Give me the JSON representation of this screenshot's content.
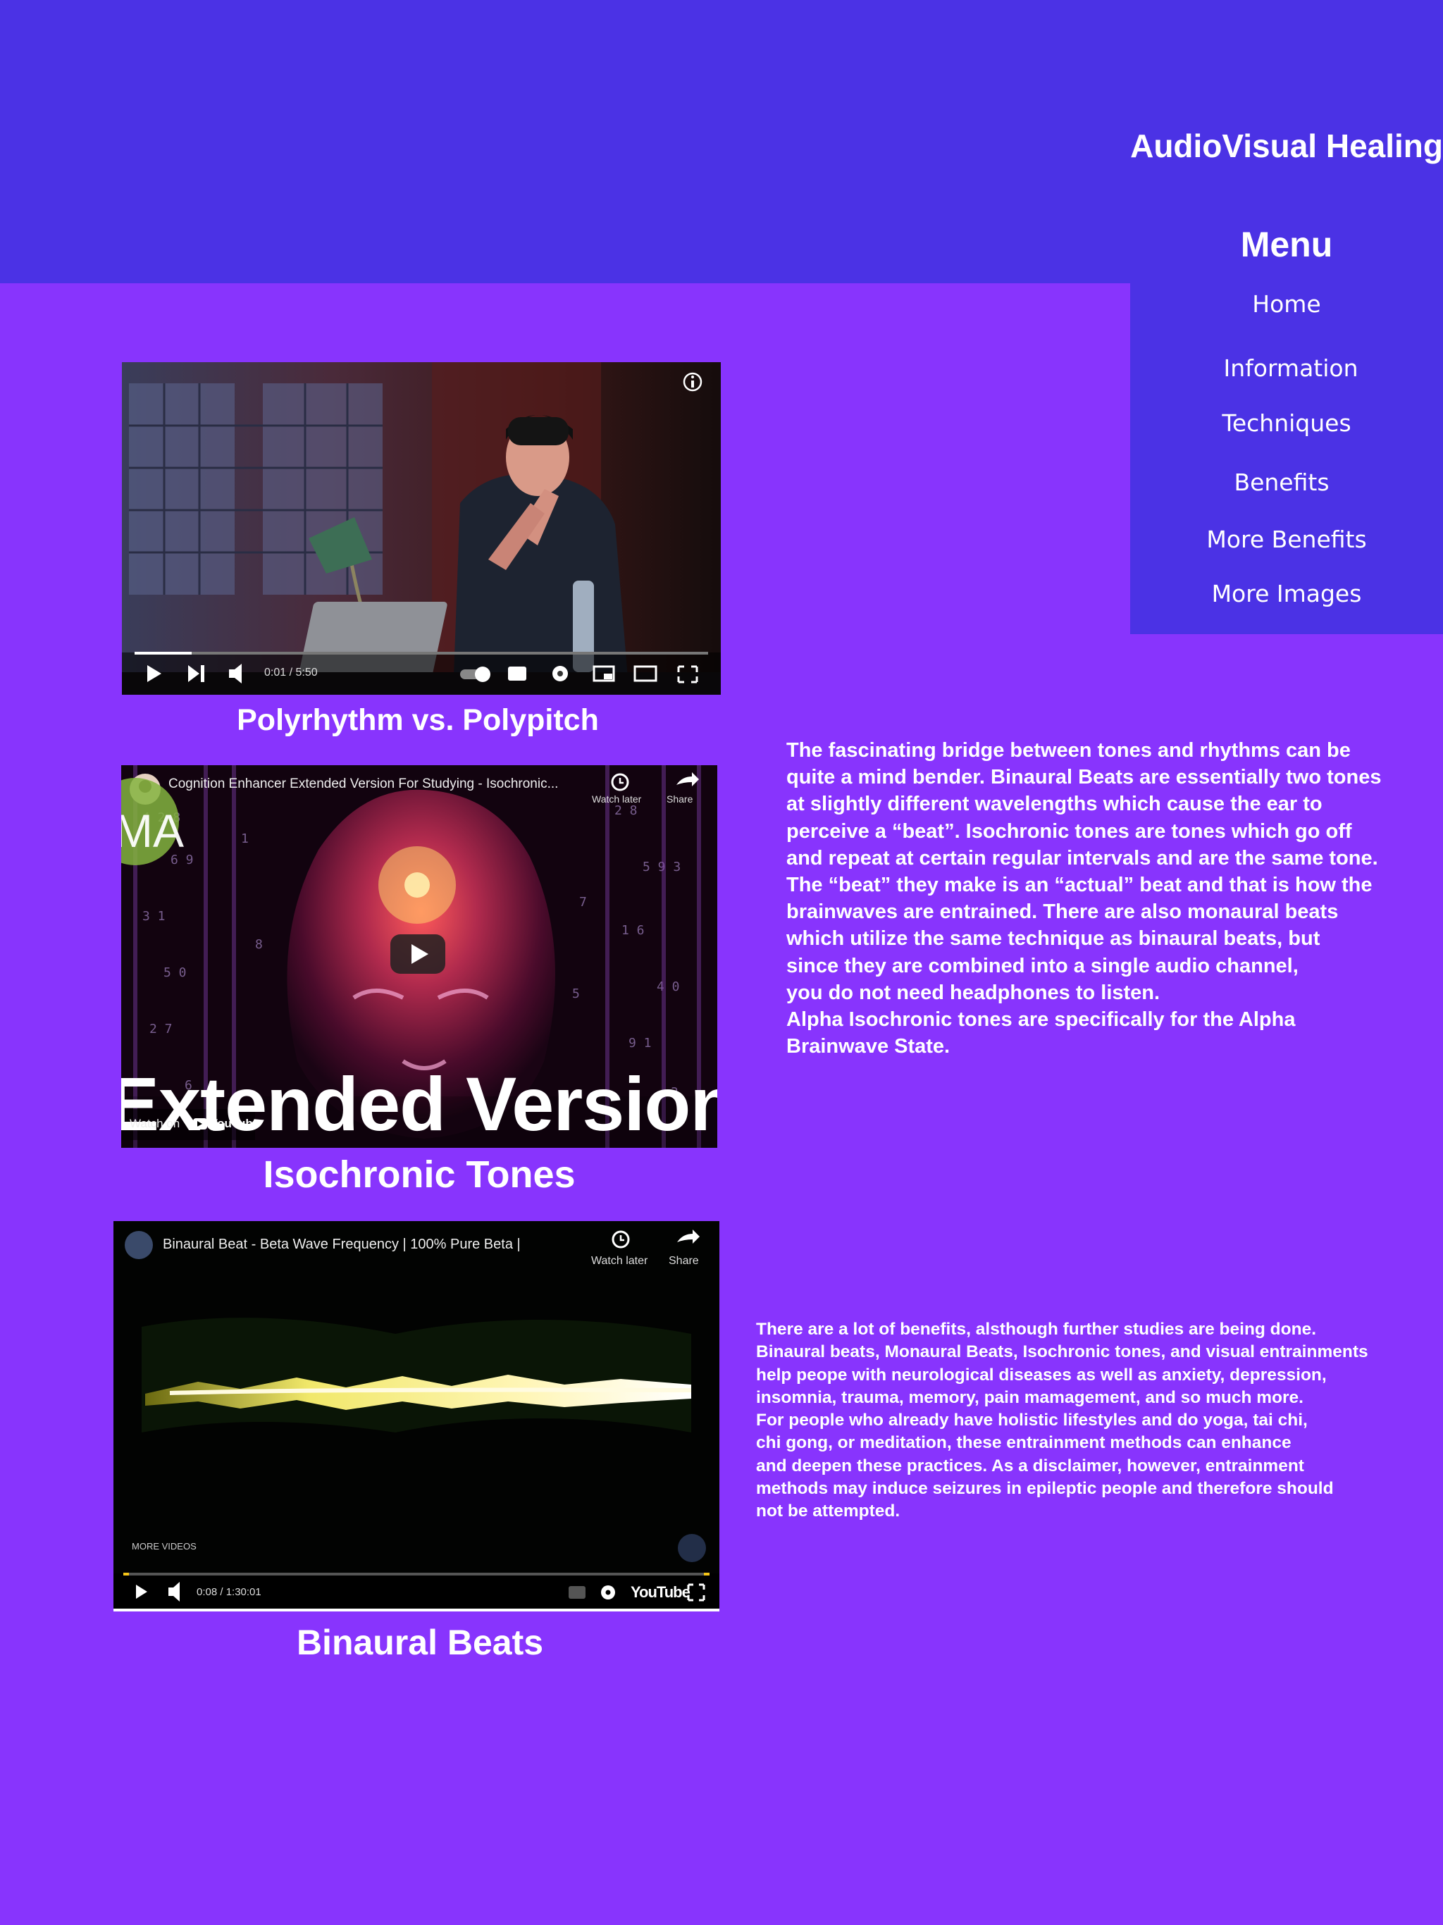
{
  "header": {
    "site_title": "AudioVisual Healing"
  },
  "menu": {
    "title": "Menu",
    "items": [
      "Home",
      "Information",
      "Techniques",
      "Benefits",
      "More Benefits",
      "More Images"
    ]
  },
  "videos": [
    {
      "caption": "Polyrhythm vs. Polypitch",
      "time": "0:01 / 5:50",
      "progress": 0.1
    },
    {
      "caption": "Isochronic Tones",
      "title": "Cognition Enhancer Extended Version For Studying - Isochronic...",
      "channel_badge": "MA",
      "overlay_text": "Extended Version",
      "watch_later": "Watch later",
      "share": "Share",
      "watch_on": "Watch on",
      "youtube": "YouTube"
    },
    {
      "caption": "Binaural Beats",
      "title": "Binaural Beat - Beta Wave Frequency | 100% Pure Beta |",
      "watch_later": "Watch later",
      "share": "Share",
      "more_videos": "MORE VIDEOS",
      "time": "0:08 / 1:30:01",
      "youtube": "YouTube",
      "progress": 0.01
    }
  ],
  "content": {
    "tones_paragraph": "The fascinating bridge between tones and rhythms can be\nquite a mind bender. Binaural Beats are essentially two tones\nat slightly different wavelengths which cause the ear to\nperceive a “beat”. Isochronic tones are tones which go off\nand repeat at certain regular intervals and are the same tone.\nThe “beat” they make is an “actual” beat and that is how the\nbrainwaves are entrained. There are also monaural beats\nwhich utilize the same technique as binaural beats, but\nsince they are combined into a single audio channel,\nyou do not need headphones to listen.\nAlpha Isochronic tones are specifically for the Alpha\nBrainwave State.",
    "benefits_paragraph": "There are a lot of benefits, alsthough further studies are being done.\nBinaural beats, Monaural Beats, Isochronic tones, and visual entrainments\nhelp peope with neurological diseases as well as anxiety, depression,\ninsomnia, trauma, memory, pain mamagement, and so much more.\nFor people who already have holistic lifestyles and do yoga, tai chi,\nchi gong, or meditation, these entrainment methods can enhance\nand deepen these practices. As a disclaimer, however, entrainment\nmethods may induce seizures in epileptic people and therefore should\nnot be attempted."
  },
  "colors": {
    "page_bg": "#8834fd",
    "header_bg": "#4b32e5",
    "text": "#ffffff"
  }
}
